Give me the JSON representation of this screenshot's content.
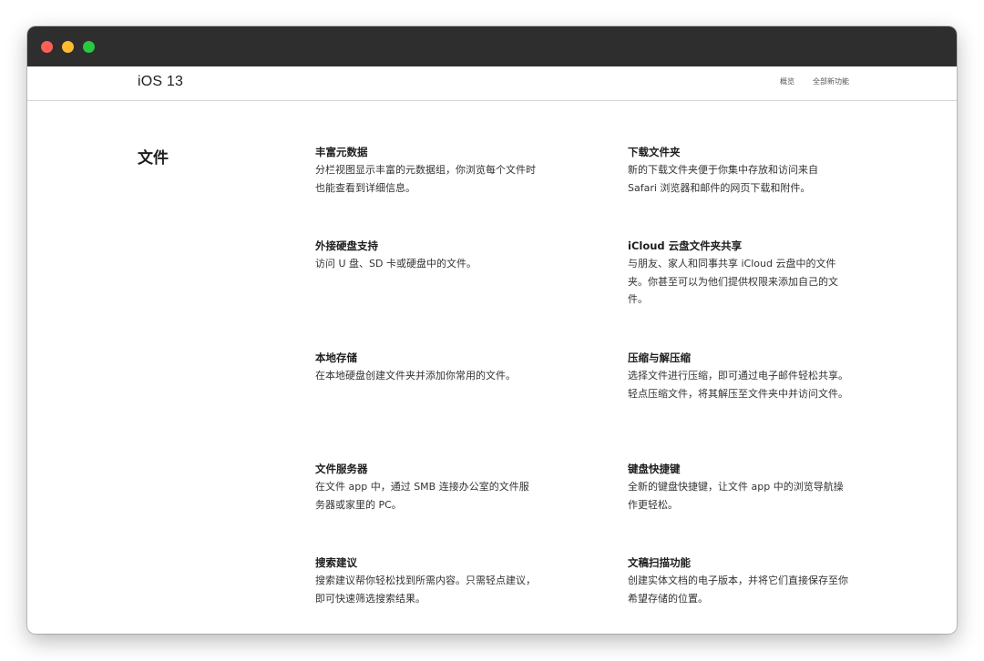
{
  "window": {
    "traffic_colors": {
      "close": "#fe5f57",
      "minimize": "#febc2e",
      "maximize": "#28c840"
    }
  },
  "header": {
    "title": "iOS 13",
    "links": [
      "概览",
      "全部新功能"
    ]
  },
  "section": {
    "title": "文件",
    "features": [
      {
        "title": "丰富元数据",
        "desc": "分栏视图显示丰富的元数据组，你浏览每个文件时也能查看到详细信息。"
      },
      {
        "title": "下载文件夹",
        "desc": "新的下载文件夹便于你集中存放和访问来自 Safari 浏览器和邮件的网页下载和附件。"
      },
      {
        "title": "外接硬盘支持",
        "desc": "访问 U 盘、SD 卡或硬盘中的文件。"
      },
      {
        "title": "iCloud 云盘文件夹共享",
        "desc": "与朋友、家人和同事共享 iCloud 云盘中的文件夹。你甚至可以为他们提供权限来添加自己的文件。"
      },
      {
        "title": "本地存储",
        "desc": "在本地硬盘创建文件夹并添加你常用的文件。"
      },
      {
        "title": "压缩与解压缩",
        "desc": "选择文件进行压缩，即可通过电子邮件轻松共享。轻点压缩文件，将其解压至文件夹中并访问文件。"
      },
      {
        "title": "文件服务器",
        "desc": "在文件 app 中，通过 SMB 连接办公室的文件服务器或家里的 PC。"
      },
      {
        "title": "键盘快捷键",
        "desc": "全新的键盘快捷键，让文件 app 中的浏览导航操作更轻松。"
      },
      {
        "title": "搜索建议",
        "desc": "搜索建议帮你轻松找到所需内容。只需轻点建议，即可快速筛选搜索结果。"
      },
      {
        "title": "文稿扫描功能",
        "desc": "创建实体文档的电子版本，并将它们直接保存至你希望存储的位置。"
      }
    ]
  }
}
